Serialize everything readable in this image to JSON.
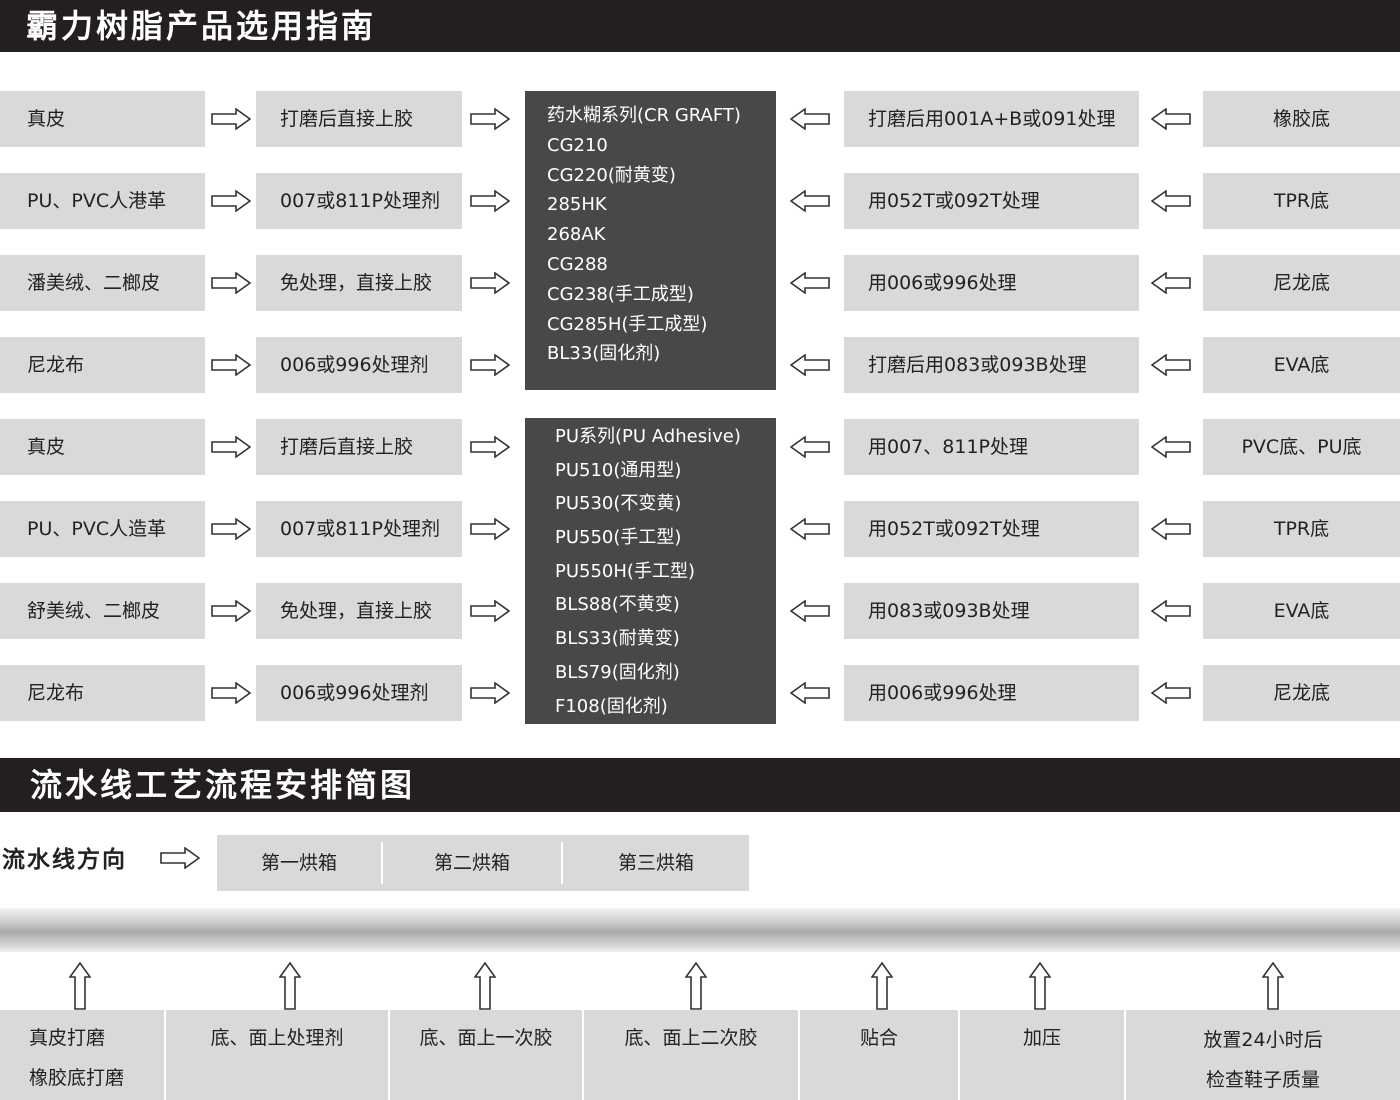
{
  "header": {
    "title": "霸力树脂产品选用指南"
  },
  "section2": {
    "title": "流水线工艺流程安排简图"
  },
  "rows": [
    {
      "material": "真皮",
      "treatment": "打磨后直接上胶",
      "sole_treatment": "打磨后用001A+B或091处理",
      "sole": "橡胶底"
    },
    {
      "material": "PU、PVC人港革",
      "treatment": "007或811P处理剂",
      "sole_treatment": "用052T或092T处理",
      "sole": "TPR底"
    },
    {
      "material": "潘美绒、二榔皮",
      "treatment": "免处理，直接上胶",
      "sole_treatment": "用006或996处理",
      "sole": "尼龙底"
    },
    {
      "material": "尼龙布",
      "treatment": "006或996处理剂",
      "sole_treatment": "打磨后用083或093B处理",
      "sole": "EVA底"
    },
    {
      "material": "真皮",
      "treatment": "打磨后直接上胶",
      "sole_treatment": "用007、811P处理",
      "sole": "PVC底、PU底"
    },
    {
      "material": "PU、PVC人造革",
      "treatment": "007或811P处理剂",
      "sole_treatment": "用052T或092T处理",
      "sole": "TPR底"
    },
    {
      "material": "舒美绒、二榔皮",
      "treatment": "免处理，直接上胶",
      "sole_treatment": "用083或093B处理",
      "sole": "EVA底"
    },
    {
      "material": "尼龙布",
      "treatment": "006或996处理剂",
      "sole_treatment": "用006或996处理",
      "sole": "尼龙底"
    }
  ],
  "product_groups": [
    {
      "items": [
        "药水糊系列(CR GRAFT)",
        "CG210",
        "CG220(耐黄变)",
        "285HK",
        "268AK",
        "CG288",
        "CG238(手工成型)",
        "CG285H(手工成型)",
        "BL33(固化剂)"
      ]
    },
    {
      "items": [
        "PU系列(PU Adhesive)",
        "PU510(通用型)",
        "PU530(不变黄)",
        "PU550(手工型)",
        "PU550H(手工型)",
        "BLS88(不黄变)",
        "BLS33(耐黄变)",
        "BLS79(固化剂)",
        "F108(固化剂)"
      ]
    }
  ],
  "flow": {
    "direction_label": "流水线方向",
    "ovens": [
      "第一烘箱",
      "第二烘箱",
      "第三烘箱"
    ],
    "steps": [
      [
        "真皮打磨",
        "橡胶底打磨"
      ],
      [
        "底、面上处理剂"
      ],
      [
        "底、面上一次胶"
      ],
      [
        "底、面上二次胶"
      ],
      [
        "贴合"
      ],
      [
        "加压"
      ],
      [
        "放置24小时后",
        "检查鞋子质量"
      ]
    ]
  },
  "colors": {
    "header_bg": "#231f20",
    "cell_bg": "#d9d9da",
    "product_bg": "#4a4748"
  },
  "icons": {
    "right": "hollow-right-arrow-icon",
    "left": "hollow-left-arrow-icon",
    "up": "hollow-up-arrow-icon"
  }
}
